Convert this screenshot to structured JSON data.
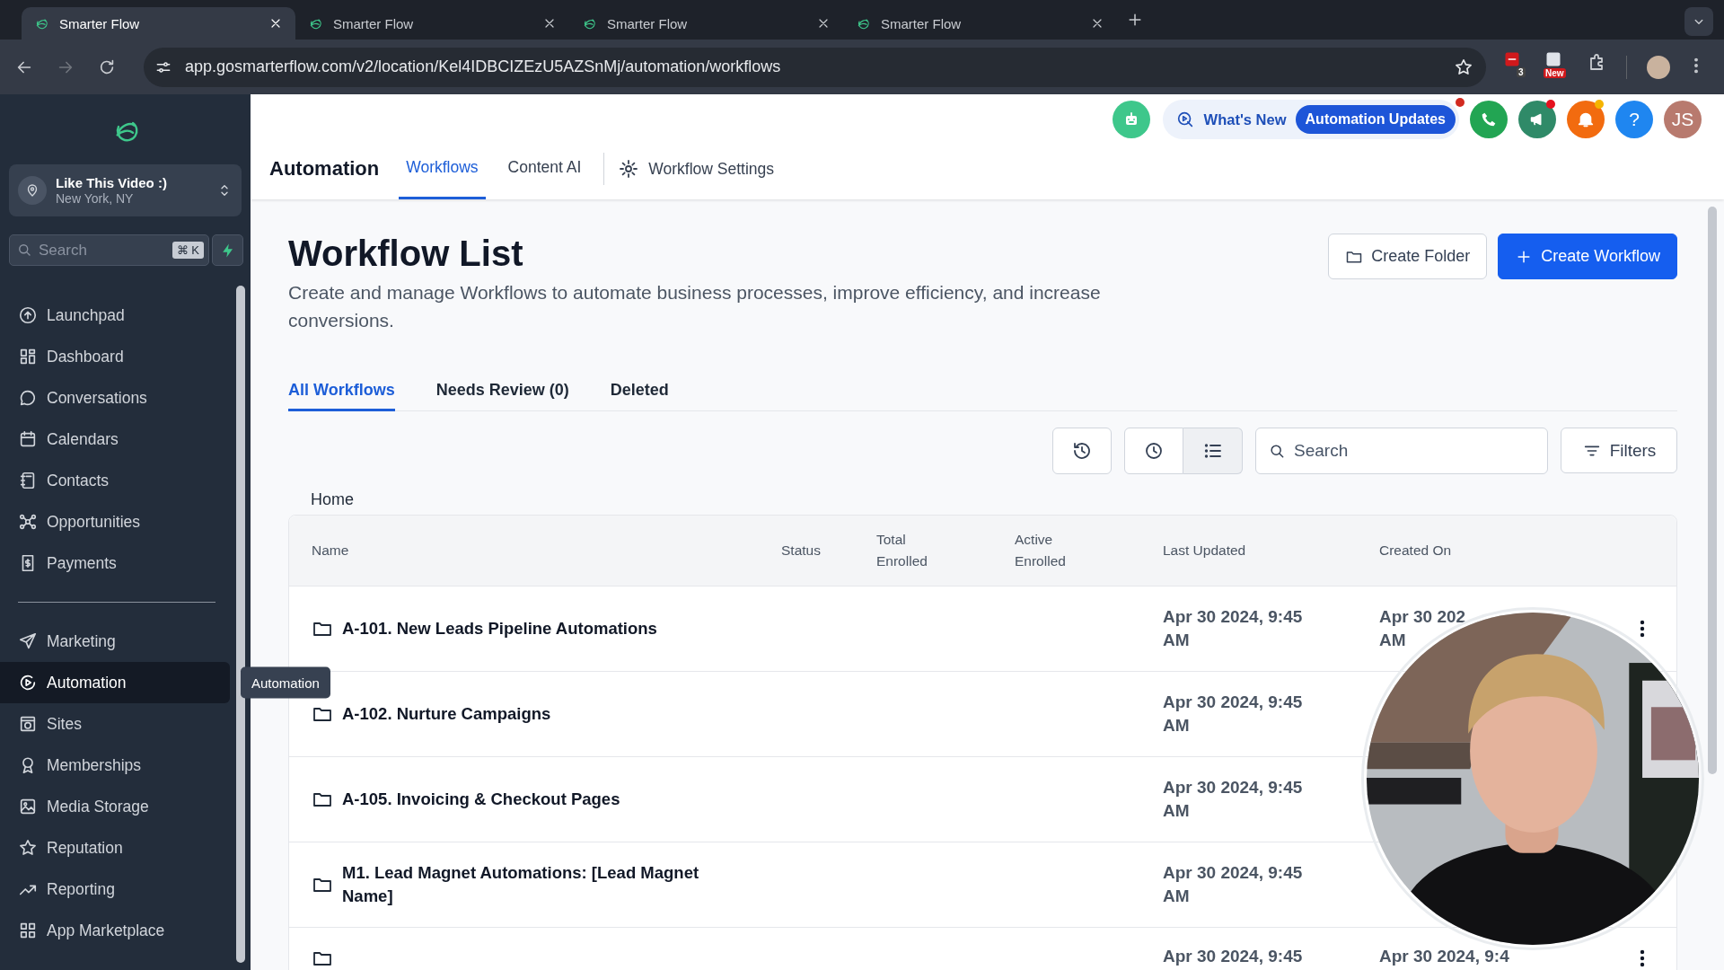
{
  "browser": {
    "tabs": [
      {
        "title": "Smarter Flow",
        "selected": true
      },
      {
        "title": "Smarter Flow",
        "selected": false
      },
      {
        "title": "Smarter Flow",
        "selected": false
      },
      {
        "title": "Smarter Flow",
        "selected": false
      }
    ],
    "url": "app.gosmarterflow.com/v2/location/Kel4IDBCIZEzU5AZSnMj/automation/workflows",
    "extension_badges": [
      "3",
      "New"
    ]
  },
  "sidebar": {
    "location": {
      "name": "Like This Video :)",
      "city": "New York, NY"
    },
    "search": {
      "placeholder": "Search",
      "shortcut": "⌘ K"
    },
    "groups": [
      [
        {
          "label": "Launchpad",
          "selected": false
        },
        {
          "label": "Dashboard",
          "selected": false
        },
        {
          "label": "Conversations",
          "selected": false
        },
        {
          "label": "Calendars",
          "selected": false
        },
        {
          "label": "Contacts",
          "selected": false
        },
        {
          "label": "Opportunities",
          "selected": false
        },
        {
          "label": "Payments",
          "selected": false
        }
      ],
      [
        {
          "label": "Marketing",
          "selected": false
        },
        {
          "label": "Automation",
          "selected": true
        },
        {
          "label": "Sites",
          "selected": false
        },
        {
          "label": "Memberships",
          "selected": false
        },
        {
          "label": "Media Storage",
          "selected": false
        },
        {
          "label": "Reputation",
          "selected": false
        },
        {
          "label": "Reporting",
          "selected": false
        },
        {
          "label": "App Marketplace",
          "selected": false
        }
      ]
    ],
    "tooltip": "Automation"
  },
  "header": {
    "whats_new": "What's New",
    "updates_badge": "Automation Updates",
    "updates_dot": true,
    "actions": [
      {
        "kind": "phone",
        "dot": false
      },
      {
        "kind": "megaphone",
        "dot": true,
        "color": "#e5121e"
      },
      {
        "kind": "bell",
        "dot": true,
        "color": "#f5b400"
      },
      {
        "kind": "help",
        "text": "?",
        "dot": false
      },
      {
        "kind": "avatar",
        "text": "JS",
        "dot": false
      }
    ],
    "title": "Automation",
    "tabs": [
      {
        "label": "Workflows",
        "selected": true
      },
      {
        "label": "Content AI",
        "selected": false
      }
    ],
    "settings_link": "Workflow Settings"
  },
  "page": {
    "title": "Workflow List",
    "description": "Create and manage Workflows to automate business processes, improve efficiency, and increase conversions.",
    "buttons": [
      {
        "label": "Create Folder",
        "kind": "secondary"
      },
      {
        "label": "Create Workflow",
        "kind": "primary"
      }
    ],
    "tabs": [
      {
        "label": "All Workflows",
        "selected": true
      },
      {
        "label": "Needs Review (0)",
        "selected": false
      },
      {
        "label": "Deleted",
        "selected": false
      }
    ],
    "view_buttons": [
      {
        "kind": "history",
        "selected": false
      },
      {
        "kind": "clock",
        "selected": false
      },
      {
        "kind": "list",
        "selected": true
      }
    ],
    "search": {
      "placeholder": "Search"
    },
    "filters": "Filters",
    "breadcrumb": "Home",
    "table": {
      "columns": [
        "Name",
        "Status",
        "Total Enrolled",
        "Active Enrolled",
        "Last Updated",
        "Created On"
      ],
      "rows": [
        {
          "name": "A-101. New Leads Pipeline Automations",
          "last_updated": [
            "Apr 30 2024, 9:45",
            "AM"
          ],
          "created_on": [
            "Apr 30 202",
            "AM"
          ],
          "menu": true
        },
        {
          "name": "A-102. Nurture Campaigns",
          "last_updated": [
            "Apr 30 2024, 9:45",
            "AM"
          ],
          "menu": false
        },
        {
          "name": "A-105. Invoicing & Checkout Pages",
          "last_updated": [
            "Apr 30 2024, 9:45",
            "AM"
          ],
          "menu": false
        },
        {
          "name": "M1. Lead Magnet Automations: [Lead Magnet Name]",
          "last_updated": [
            "Apr 30 2024, 9:45",
            "AM"
          ],
          "menu": false
        },
        {
          "last_updated": [
            "Apr 30 2024, 9:45"
          ],
          "created_on": [
            "Apr 30 2024, 9:4"
          ],
          "menu": true
        }
      ]
    }
  }
}
